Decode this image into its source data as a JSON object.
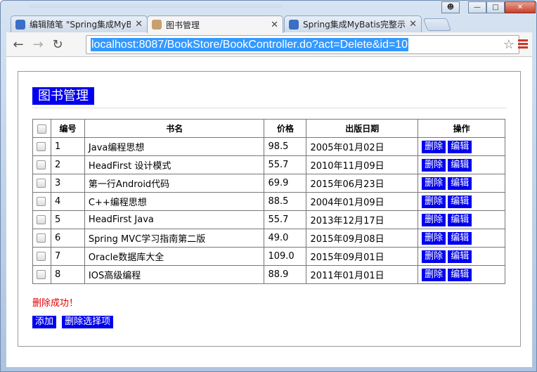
{
  "browser": {
    "tabs": [
      {
        "title": "编辑随笔 \"Spring集成MyB",
        "icon_color": "#3a6fc4",
        "active": false
      },
      {
        "title": "图书管理",
        "icon_color": "#c8a070",
        "active": true
      },
      {
        "title": "Spring集成MyBatis完整示",
        "icon_color": "#3a6fc4",
        "active": false
      }
    ],
    "url": "localhost:8087/BookStore/BookController.do?act=Delete&id=10"
  },
  "page": {
    "title": "图书管理",
    "columns": [
      "编号",
      "书名",
      "价格",
      "出版日期",
      "操作"
    ],
    "rows": [
      {
        "id": "1",
        "name": "Java编程思想",
        "price": "98.5",
        "date": "2005年01月02日"
      },
      {
        "id": "2",
        "name": "HeadFirst 设计模式",
        "price": "55.7",
        "date": "2010年11月09日"
      },
      {
        "id": "3",
        "name": "第一行Android代码",
        "price": "69.9",
        "date": "2015年06月23日"
      },
      {
        "id": "4",
        "name": "C++编程思想",
        "price": "88.5",
        "date": "2004年01月09日"
      },
      {
        "id": "5",
        "name": "HeadFirst Java",
        "price": "55.7",
        "date": "2013年12月17日"
      },
      {
        "id": "6",
        "name": "Spring MVC学习指南第二版",
        "price": "49.0",
        "date": "2015年09月08日"
      },
      {
        "id": "7",
        "name": "Oracle数据库大全",
        "price": "109.0",
        "date": "2015年09月01日"
      },
      {
        "id": "8",
        "name": "IOS高级编程",
        "price": "88.9",
        "date": "2011年01月01日"
      }
    ],
    "row_actions": {
      "delete": "删除",
      "edit": "编辑"
    },
    "message": "删除成功！",
    "buttons": {
      "add": "添加",
      "delete_selected": "删除选择项"
    }
  },
  "colors": {
    "accent": "#0000ee",
    "message": "#e00000"
  }
}
